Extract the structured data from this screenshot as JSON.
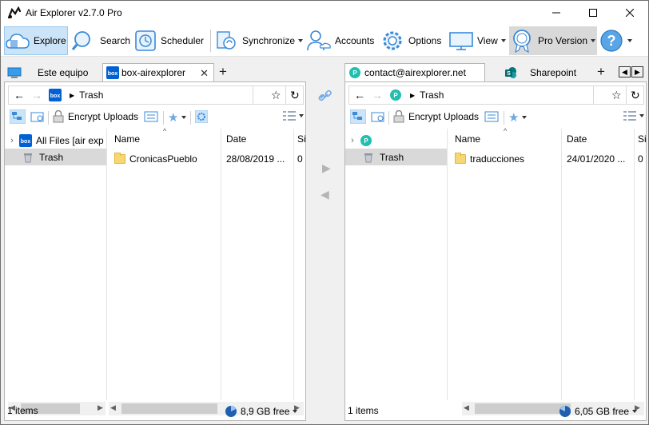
{
  "window": {
    "title": "Air Explorer v2.7.0 Pro"
  },
  "toolbar": {
    "explore": "Explore",
    "search": "Search",
    "scheduler": "Scheduler",
    "synchronize": "Synchronize",
    "accounts": "Accounts",
    "options": "Options",
    "view": "View",
    "pro_version": "Pro Version"
  },
  "left": {
    "tabs": [
      {
        "label": "Este equipo"
      },
      {
        "label": "box-airexplorer"
      }
    ],
    "breadcrumb": "Trash",
    "encrypt_label": "Encrypt Uploads",
    "tree": [
      {
        "label": "All Files [air exp"
      },
      {
        "label": "Trash"
      }
    ],
    "columns": {
      "name": "Name",
      "date": "Date",
      "size": "Si"
    },
    "rows": [
      {
        "name": "CronicasPueblo",
        "date": "28/08/2019 ...",
        "size": "0"
      }
    ],
    "status_items": "1 items",
    "status_free": "8,9 GB free"
  },
  "right": {
    "tabs": [
      {
        "label": "contact@airexplorer.net"
      },
      {
        "label": "Sharepoint"
      }
    ],
    "breadcrumb": "Trash",
    "encrypt_label": "Encrypt Uploads",
    "tree": [
      {
        "label": ""
      },
      {
        "label": "Trash"
      }
    ],
    "columns": {
      "name": "Name",
      "date": "Date",
      "size": "Si"
    },
    "rows": [
      {
        "name": "traducciones",
        "date": "24/01/2020 ...",
        "size": "0"
      }
    ],
    "status_items": "1 items",
    "status_free": "6,05 GB free"
  },
  "colors": {
    "accent": "#0078d7",
    "selected_tab": "#cce4f7",
    "box_blue": "#0061d5",
    "pcloud": "#20bfb0"
  }
}
